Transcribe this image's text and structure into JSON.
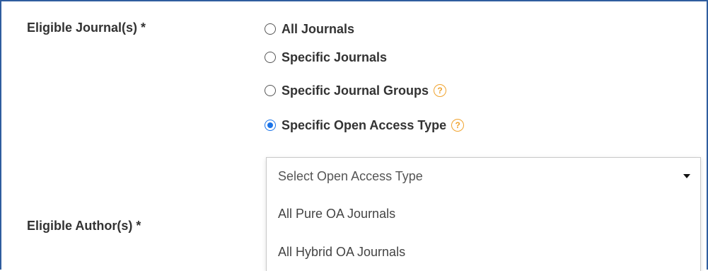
{
  "form": {
    "eligible_journals_label": "Eligible Journal(s) *",
    "eligible_authors_label": "Eligible Author(s) *",
    "journal_options": [
      {
        "label": "All Journals",
        "selected": false,
        "help": false
      },
      {
        "label": "Specific Journals",
        "selected": false,
        "help": false
      },
      {
        "label": "Specific Journal Groups",
        "selected": false,
        "help": true
      },
      {
        "label": "Specific Open Access Type",
        "selected": true,
        "help": true
      }
    ],
    "help_icon_glyph": "?",
    "open_access_dropdown": {
      "placeholder": "Select Open Access Type",
      "options": [
        "All Pure OA Journals",
        "All Hybrid OA Journals"
      ]
    }
  },
  "colors": {
    "frame_border": "#2f5d9e",
    "radio_selected": "#1a73e8",
    "help_icon": "#f0a32e"
  }
}
